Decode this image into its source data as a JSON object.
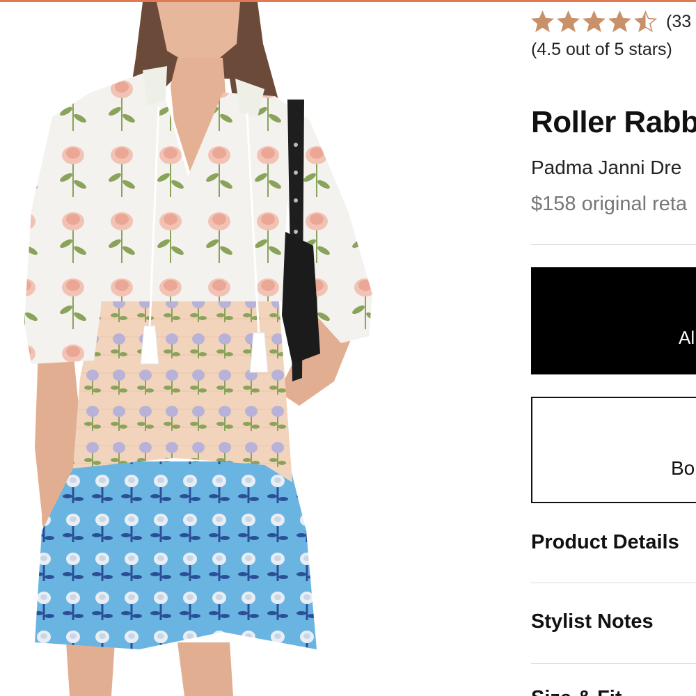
{
  "colors": {
    "accent_bar": "#e07a55",
    "star": "#c8916a",
    "primary_button_bg": "#000000",
    "price_text": "#767676"
  },
  "product_image": {
    "icon": "product-photo"
  },
  "rating": {
    "value": 4.5,
    "max": 5,
    "count_text": "(33",
    "summary": "(4.5 out of 5 stars)"
  },
  "product": {
    "brand": "Roller Rabb",
    "name": "Padma Janni Dre",
    "retail_price": "$158 original reta"
  },
  "actions": {
    "primary_label": "Al",
    "secondary_label": "Bo"
  },
  "accordion": [
    {
      "label": "Product Details"
    },
    {
      "label": "Stylist Notes"
    },
    {
      "label": "Size & Fit"
    }
  ]
}
